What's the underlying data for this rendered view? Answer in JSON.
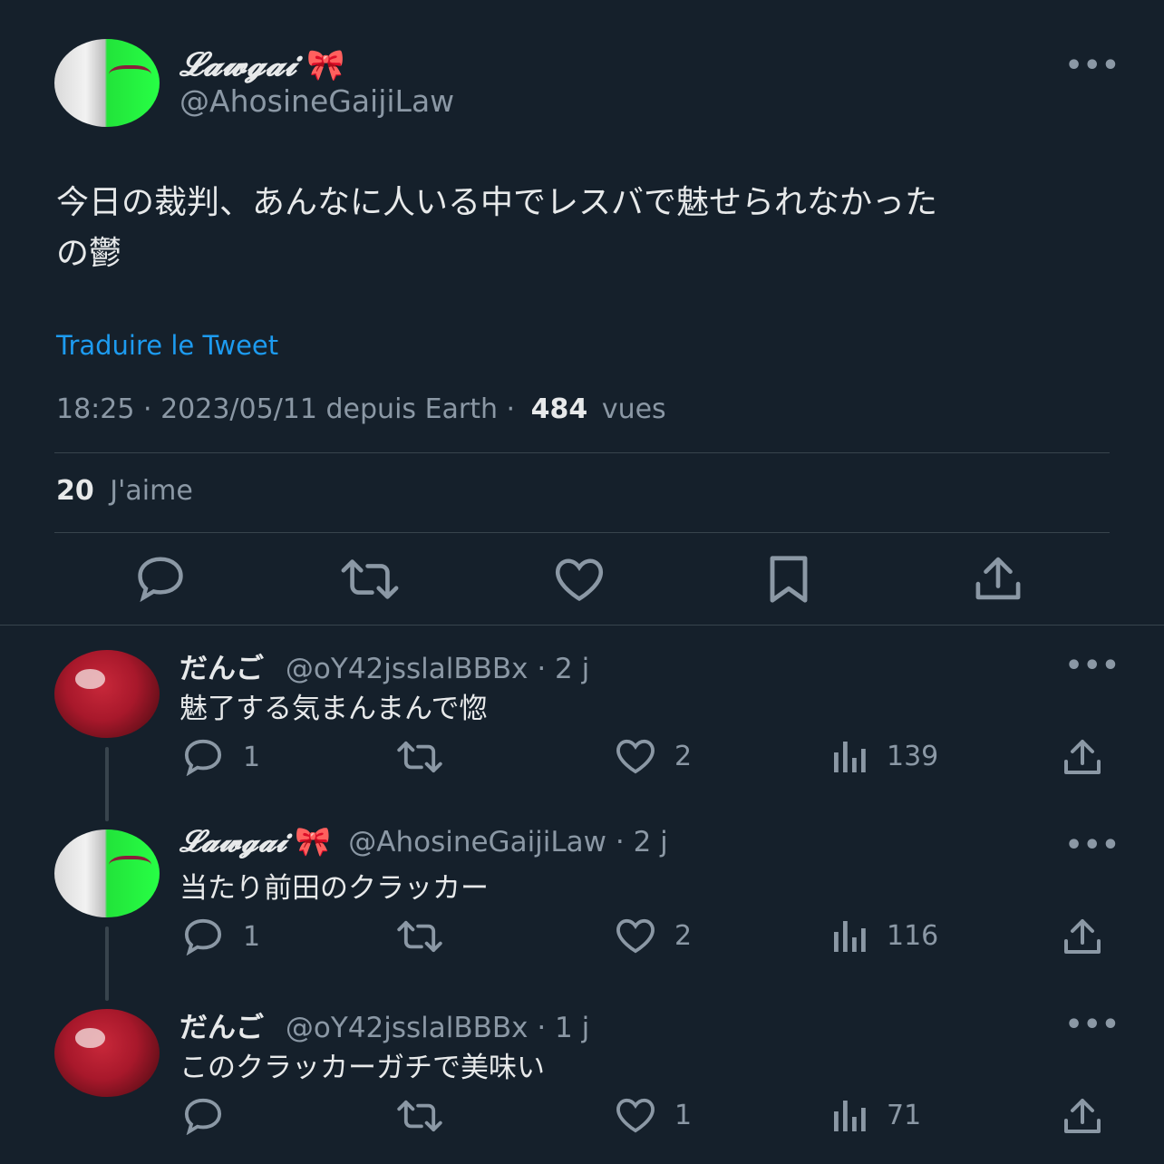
{
  "tweet": {
    "author_name": "𝓛𝓪𝔀𝓰𝓪𝓲",
    "author_emoji": "🎀",
    "author_handle": "@AhosineGaijiLaw",
    "text_line1": "今日の裁判、あんなに人いる中でレスバで魅せられなかった",
    "text_line2": "の鬱",
    "translate_label": "Traduire le Tweet",
    "meta_time": "18:25 · 2023/05/11 depuis Earth ·",
    "views_count": "484",
    "views_label": "vues",
    "likes_count": "20",
    "likes_label": "J'aime"
  },
  "replies": [
    {
      "name": "だんご",
      "handle": "@oY42jsslalBBBx · 2 j",
      "text": "魅了する気まんまんで惚",
      "reply_count": "1",
      "like_count": "2",
      "view_count": "139"
    },
    {
      "name": "𝓛𝓪𝔀𝓰𝓪𝓲",
      "emoji": "🎀",
      "handle": "@AhosineGaijiLaw · 2 j",
      "text": "当たり前田のクラッカー",
      "reply_count": "1",
      "like_count": "2",
      "view_count": "116"
    },
    {
      "name": "だんご",
      "handle": "@oY42jsslalBBBx · 1 j",
      "text": "このクラッカーガチで美味い",
      "reply_count": "",
      "like_count": "1",
      "view_count": "71"
    }
  ],
  "colors": {
    "background": "#15202b",
    "text": "#e7e9ea",
    "muted": "#8b98a5",
    "link": "#1d9bf0",
    "divider": "#38444d"
  }
}
